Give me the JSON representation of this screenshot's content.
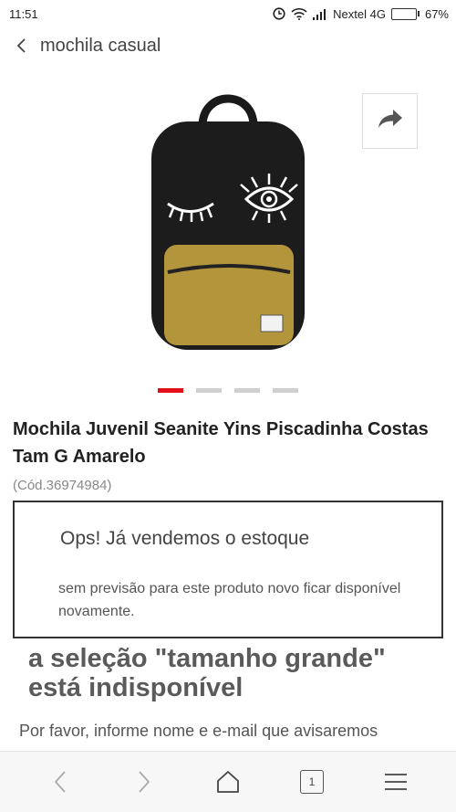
{
  "status_bar": {
    "time": "11:51",
    "carrier": "Nextel 4G",
    "battery_percent": "67%",
    "battery_level": 0.67
  },
  "header": {
    "title": "mochila casual"
  },
  "gallery": {
    "image_count": 4,
    "active_index": 0,
    "accent_color": "#e3101a"
  },
  "product": {
    "title": "Mochila Juvenil Seanite Yins Piscadinha Costas Tam G Amarelo",
    "code": "(Cód.36974984)"
  },
  "stock_notice": {
    "title": "Ops! Já vendemos o estoque",
    "description": "sem previsão para este produto novo ficar disponível novamente."
  },
  "selection_message": "a seleção \"tamanho grande\" está indisponível",
  "notify_text": "Por favor, informe nome e e-mail que avisaremos",
  "bottom_nav": {
    "tab_count": "1"
  },
  "icons": [
    "back-icon",
    "share-icon",
    "clock-icon",
    "wifi-icon",
    "signal-icon",
    "battery-icon",
    "nav-back-icon",
    "nav-forward-icon",
    "home-icon",
    "tabs-icon",
    "menu-icon"
  ]
}
